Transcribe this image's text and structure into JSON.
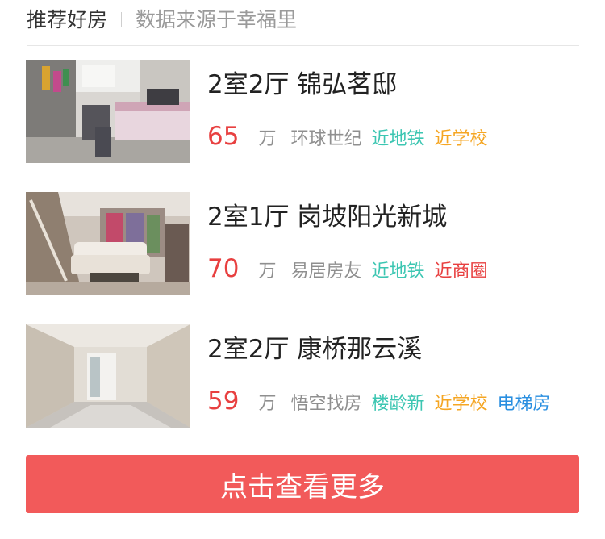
{
  "header": {
    "title": "推荐好房",
    "source": "数据来源于幸福里"
  },
  "listings": [
    {
      "title": "2室2厅  锦弘茗邸",
      "price": "65",
      "unit": "万",
      "agency": "环球世纪",
      "tags": [
        {
          "label": "近地铁",
          "color": "#3cc6b2"
        },
        {
          "label": "近学校",
          "color": "#f5a623"
        }
      ],
      "photo_icon": "bedroom-photo"
    },
    {
      "title": "2室1厅  岗坡阳光新城",
      "price": "70",
      "unit": "万",
      "agency": "易居房友",
      "tags": [
        {
          "label": "近地铁",
          "color": "#3cc6b2"
        },
        {
          "label": "近商圈",
          "color": "#e84040"
        }
      ],
      "photo_icon": "living-room-photo"
    },
    {
      "title": "2室2厅  康桥那云溪",
      "price": "59",
      "unit": "万",
      "agency": "悟空找房",
      "tags": [
        {
          "label": "楼龄新",
          "color": "#3cc6b2"
        },
        {
          "label": "近学校",
          "color": "#f5a623"
        },
        {
          "label": "电梯房",
          "color": "#2a8fe0"
        }
      ],
      "photo_icon": "empty-room-photo"
    }
  ],
  "more_button": {
    "label": "点击查看更多",
    "color": "#f25a5a"
  }
}
